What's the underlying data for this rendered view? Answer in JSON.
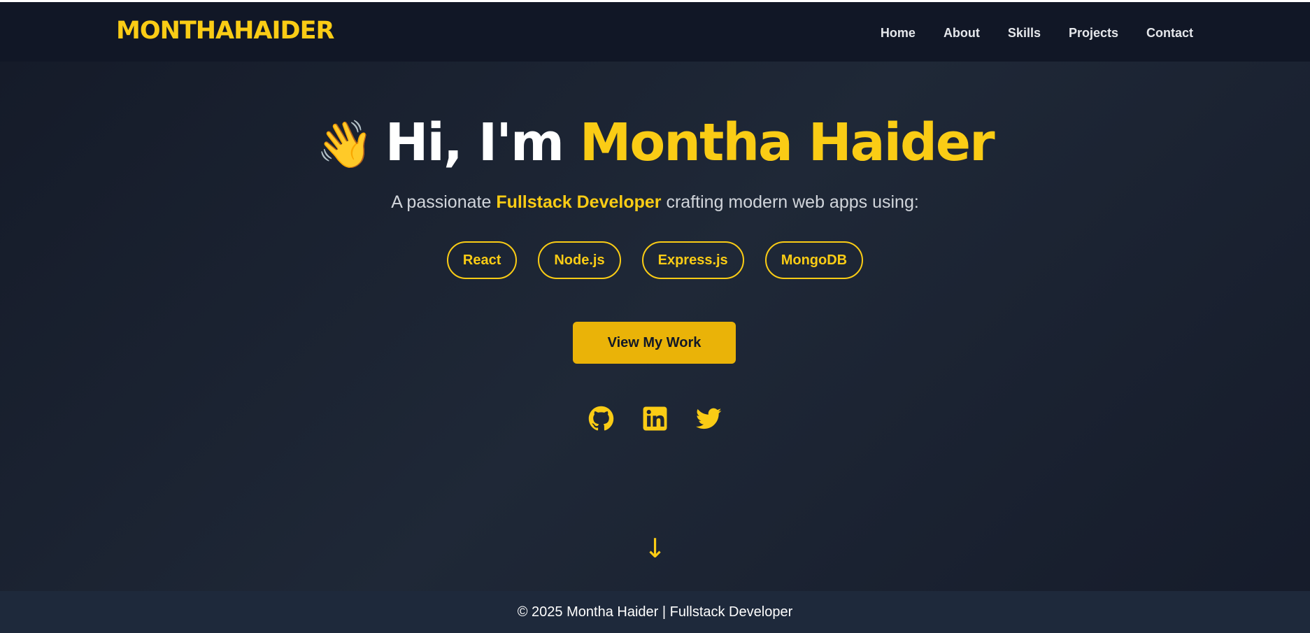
{
  "header": {
    "logo": "MONTHAHAIDER",
    "nav": [
      {
        "label": "Home"
      },
      {
        "label": "About"
      },
      {
        "label": "Skills"
      },
      {
        "label": "Projects"
      },
      {
        "label": "Contact"
      }
    ]
  },
  "hero": {
    "wave_emoji": "👋",
    "greeting": "Hi, I'm",
    "name": "Montha Haider",
    "subtitle_prefix": "A passionate",
    "subtitle_highlight": "Fullstack Developer",
    "subtitle_suffix": "crafting modern web apps using:",
    "technologies": [
      "React",
      "Node.js",
      "Express.js",
      "MongoDB"
    ],
    "cta_label": "View My Work",
    "socials": [
      {
        "icon": "github-icon"
      },
      {
        "icon": "linkedin-icon"
      },
      {
        "icon": "twitter-icon"
      }
    ],
    "scroll_indicator": "↓"
  },
  "footer": {
    "text": "© 2025 Montha Haider | Fullstack Developer"
  },
  "colors": {
    "accent": "#facc15",
    "button": "#eab308",
    "background": "#1f2837",
    "navbar": "#111726",
    "footer": "#1e293b"
  }
}
